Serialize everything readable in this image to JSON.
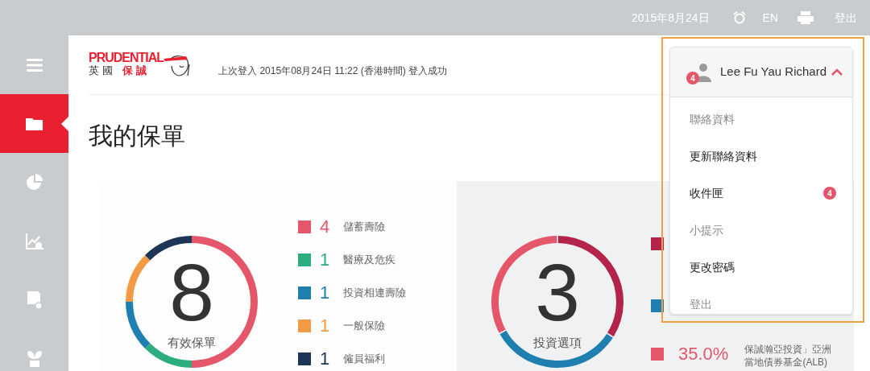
{
  "top_bar": {
    "date": "2015年8月24日",
    "language": "EN",
    "logout": "登出"
  },
  "sidebar": {
    "items": [
      {
        "selected": false
      },
      {
        "selected": true
      },
      {
        "selected": false
      },
      {
        "selected": false
      },
      {
        "selected": false
      },
      {
        "selected": false
      }
    ]
  },
  "logo": {
    "wordmark": "PRUDENTIAL",
    "subtitle_1": "英國",
    "subtitle_2": "保誠"
  },
  "last_login": "上次登入 2015年08月24日 11:22 (香港時間) 登入成功",
  "page_title": "我的保單",
  "policies": {
    "center_value": "8",
    "center_label": "有效保單",
    "legend": [
      {
        "color": "#e5566a",
        "count": "4",
        "label": "儲蓄壽險"
      },
      {
        "color": "#2bad7e",
        "count": "1",
        "label": "醫療及危疾"
      },
      {
        "color": "#1f7fb0",
        "count": "1",
        "label": "投資相連壽險"
      },
      {
        "color": "#f39a45",
        "count": "1",
        "label": "一般保險"
      },
      {
        "color": "#1d3557",
        "count": "1",
        "label": "僱員福利"
      }
    ],
    "chart_data": {
      "type": "donut",
      "values": [
        50,
        12.5,
        12.5,
        12.5,
        12.5
      ]
    }
  },
  "investments": {
    "center_value": "3",
    "center_label": "投資選項",
    "legend": [
      {
        "color": "#b3234a"
      },
      {
        "color": "#1f7fb0"
      },
      {
        "color": "#e5566a",
        "share": "35.0%",
        "fund": "保誠瀚亞投資」亞洲當地債券基金(ALB)"
      }
    ]
  },
  "user_menu": {
    "name": "Lee Fu Yau Richard",
    "badge": "4",
    "expanded": true,
    "items": [
      {
        "label": "聯絡資料",
        "dimmed": true
      },
      {
        "label": "更新聯絡資料",
        "dimmed": false
      },
      {
        "label": "收件匣",
        "dimmed": false,
        "badge": "4"
      },
      {
        "label": "小提示",
        "dimmed": true
      },
      {
        "label": "更改密碼",
        "dimmed": false
      },
      {
        "label": "登出",
        "dimmed": true
      }
    ]
  }
}
